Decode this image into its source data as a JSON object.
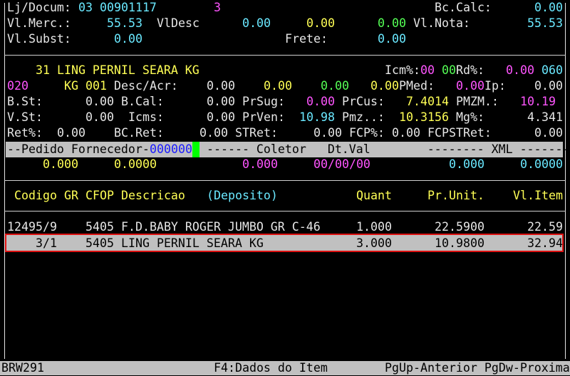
{
  "header": {
    "lj_docum_label": "Lj/Docum:",
    "lj_value": "03",
    "docum_value": "00901117",
    "serie_value": "3",
    "bc_calc_label": "Bc.Calc:",
    "bc_calc_value": "0.00",
    "vl_merc_label": "Vl.Merc.:",
    "vl_merc_value": "55.53",
    "vl_desc_label": "VlDesc",
    "vl_desc_value": "0.00",
    "vl_desc_value2": "0.00",
    "vl_desc_value3": "0.00",
    "vl_nota_label": "Vl.Nota:",
    "vl_nota_value": "55.53",
    "vl_subst_label": "Vl.Subst:",
    "vl_subst_value": "0.00",
    "frete_label": "Frete:",
    "frete_value": "0.00"
  },
  "item": {
    "title": "31 LING PERNIL SEARA KG",
    "icm_label": "Icm%:",
    "icm_value": "00",
    "rd_code": "00",
    "rd_label": "Rd%:",
    "rd_value": "0.00",
    "rd_extra": "060",
    "code": "020",
    "unit": "KG 001",
    "desc_acr_label": "Desc/Acr:",
    "desc_acr_value": "0.00",
    "desc_acr_value2": "0.00",
    "desc_acr_value3": "0.00",
    "desc_acr_value4": "0.00",
    "pmed_label": "PMed:",
    "pmed_value": "0.00",
    "ip_label": "Ip:",
    "ip_value": "0.00",
    "bst_label": "B.St:",
    "bst_value": "0.00",
    "bcal_label": "B.Cal:",
    "bcal_value": "0.00",
    "prsug_label": "PrSug:",
    "prsug_value": "0.00",
    "prcus_label": "PrCus:",
    "prcus_value": "7.4014",
    "pmzm_label": "PMZM.:",
    "pmzm_value": "10.19",
    "vst_label": "V.St:",
    "vst_value": "0.00",
    "icms_label": "Icms:",
    "icms_value": "0.00",
    "prven_label": "PrVen:",
    "prven_value": "10.98",
    "pmz_label": "Pmz..:",
    "pmz_value": "10.3156",
    "mg_label": "Mg%:",
    "mg_value": "4.341",
    "ret_label": "Ret%:",
    "ret_value": "0.00",
    "bcret_label": "BC.Ret:",
    "bcret_value": "0.00",
    "stret_label": "STRet:",
    "stret_value": "0.00",
    "fcp_label": "FCP%:",
    "fcp_value": "0.00",
    "fcpstret_label": "FCPSTRet:",
    "fcpstret_value": "0.00"
  },
  "band": {
    "left_text": "--Pedido Fornecedor-",
    "order_number": "000000",
    "right_text": " ------ Coletor   Dt.Val        -------- XML --------"
  },
  "values_row": {
    "v1": "0.000",
    "v2": "0.0000",
    "v3": "0.000",
    "v4": "00/00/00",
    "v5": "0.000",
    "v6": "0.0000"
  },
  "table": {
    "headers": {
      "codigo": "Codigo",
      "gr": "GR",
      "cfop": "CFOP",
      "descricao": "Descricao",
      "deposito": "(Deposito)",
      "quant": "Quant",
      "prunit": "Pr.Unit.",
      "vlitem": "Vl.Item"
    },
    "rows": [
      {
        "codigo": "12495/9",
        "cfop": "5405",
        "descricao": "F.D.BABY ROGER JUMBO GR C-46",
        "quant": "1.000",
        "prunit": "22.5900",
        "vlitem": "22.59"
      },
      {
        "codigo": "3/1",
        "cfop": "5405",
        "descricao": "LING PERNIL SEARA KG",
        "quant": "3.000",
        "prunit": "10.9800",
        "vlitem": "32.94"
      }
    ]
  },
  "status": {
    "program": "BRW291",
    "f4_hint": "F4:Dados do Item",
    "page_hint": "PgUp-Anterior PgDw-Proxima"
  }
}
